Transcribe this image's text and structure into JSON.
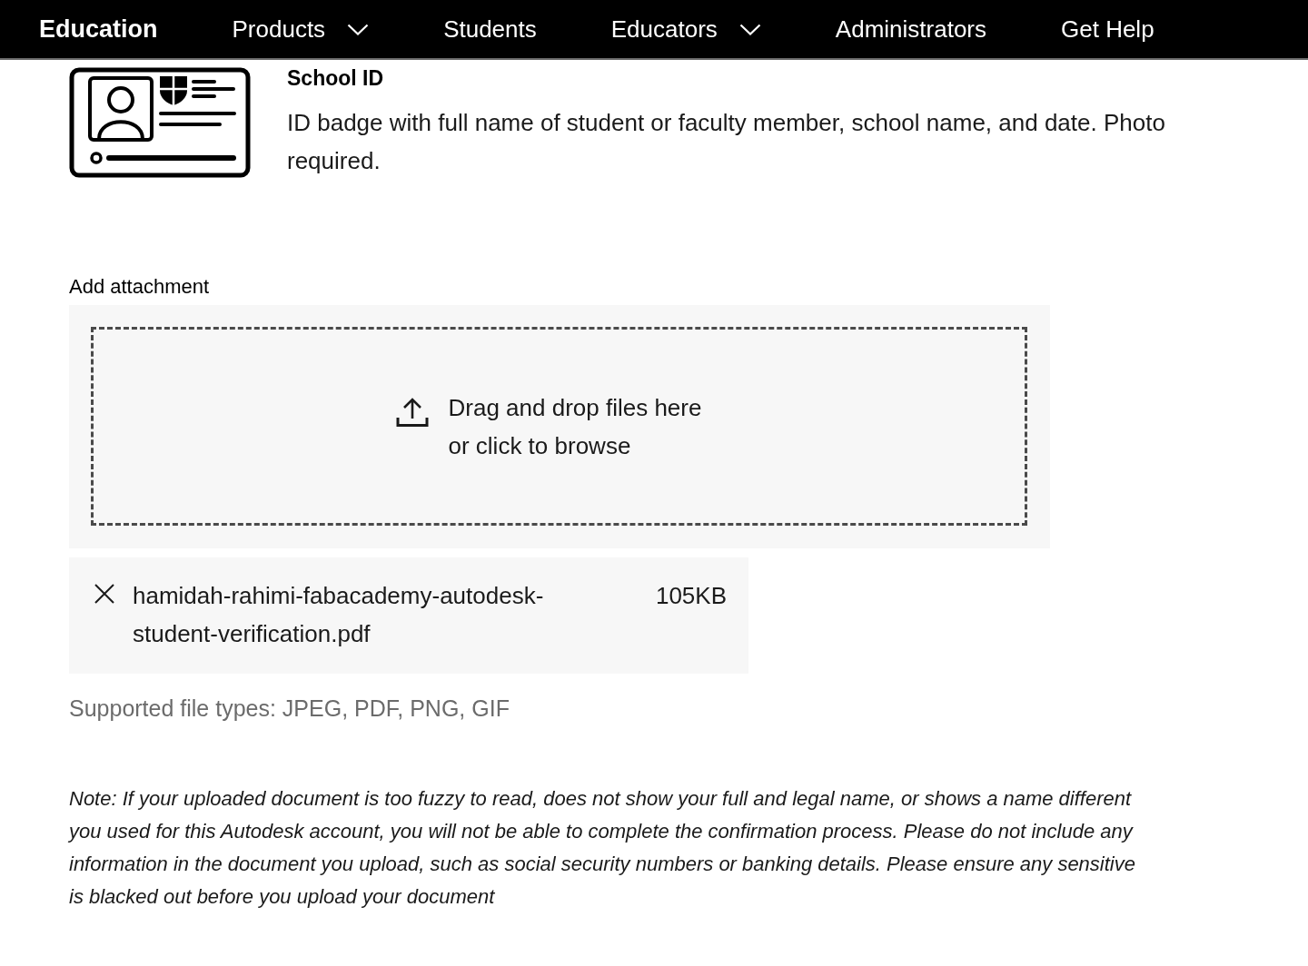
{
  "nav": {
    "brand": "Education",
    "items": [
      {
        "label": "Products",
        "kind": "menu"
      },
      {
        "label": "Students",
        "kind": "link"
      },
      {
        "label": "Educators",
        "kind": "menu"
      },
      {
        "label": "Administrators",
        "kind": "link"
      },
      {
        "label": "Get Help",
        "kind": "link"
      }
    ]
  },
  "document_option": {
    "title": "School ID",
    "description_lines": [
      "ID badge with full name of student or faculty member, school name, and date. Photo",
      "required."
    ]
  },
  "attachment": {
    "label": "Add attachment",
    "dropzone_text": "Drag and drop files here or click to browse",
    "files": [
      {
        "name": "hamidah-rahimi-fabacademy-autodesk-student-verification.pdf",
        "size": "105KB"
      }
    ],
    "supported_types": "Supported file types: JPEG, PDF, PNG, GIF"
  },
  "note_lines": [
    "Note: If your uploaded document is too fuzzy to read, does not show your full and legal name, or shows a name different",
    "you used for this Autodesk account, you will not be able to complete the confirmation process. Please do not include any",
    "information in the document you upload, such as social security numbers or banking details. Please ensure any sensitive",
    "is blacked out before you upload your document"
  ]
}
